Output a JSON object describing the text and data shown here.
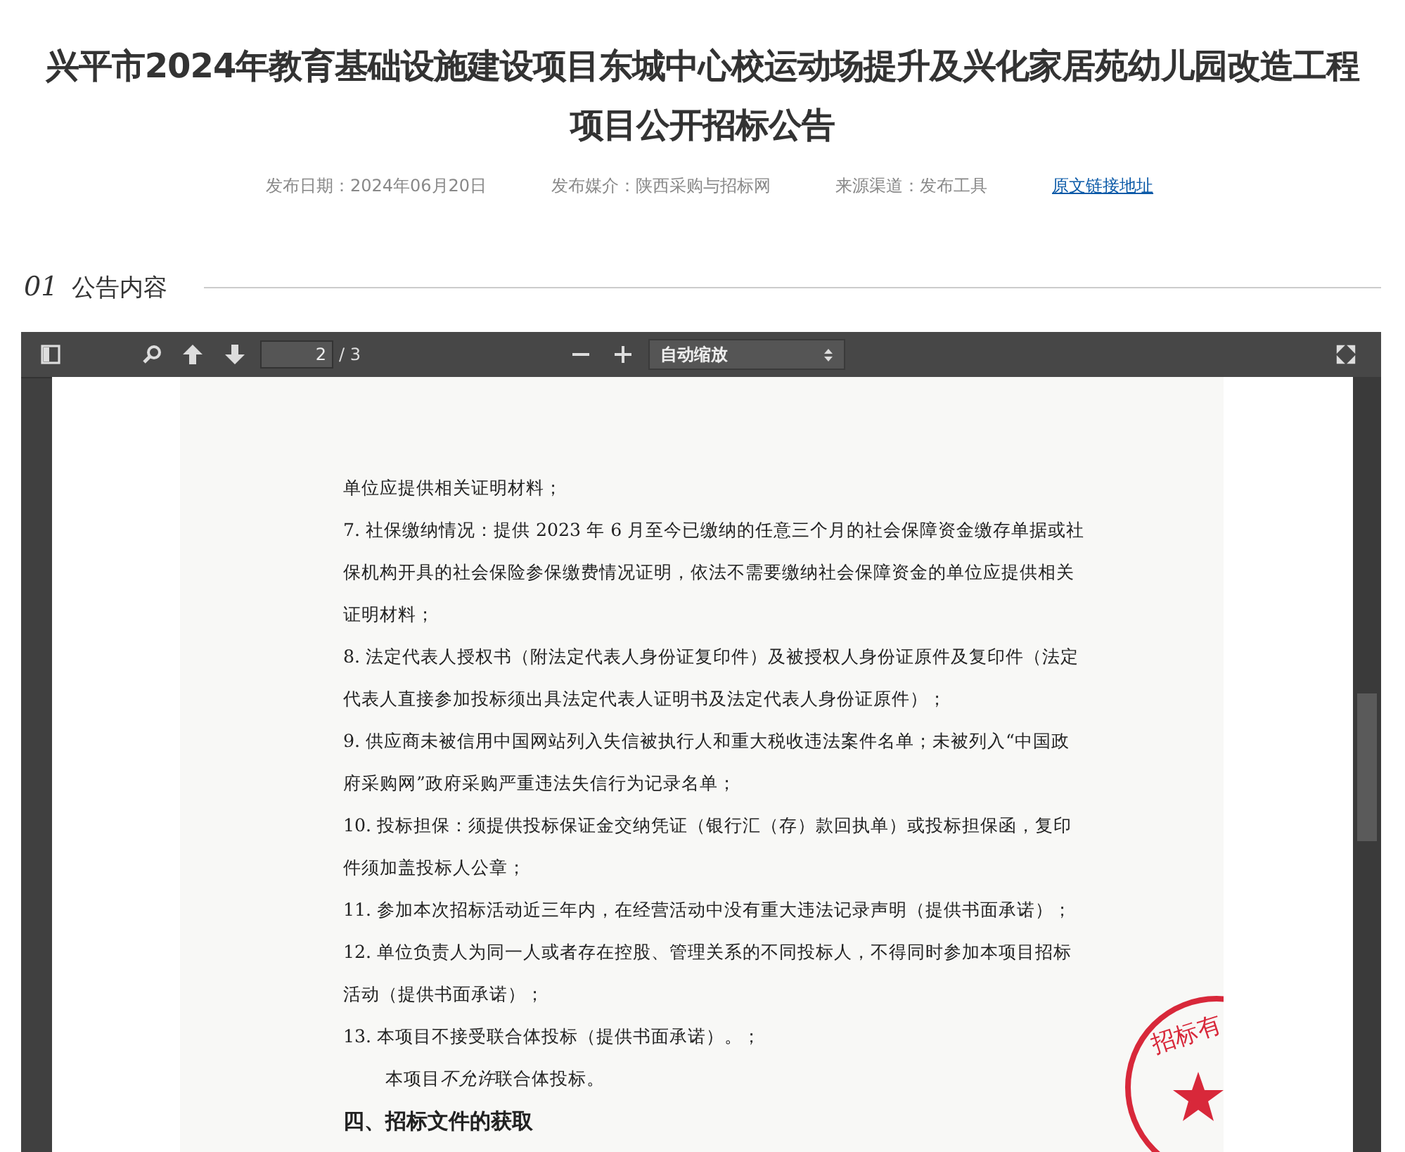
{
  "title": "兴平市2024年教育基础设施建设项目东城中心校运动场提升及兴化家居苑幼儿园改造工程项目公开招标公告",
  "meta": [
    {
      "kind": "text",
      "text": "发布日期：2024年06月20日"
    },
    {
      "kind": "text",
      "text": "发布媒介：陕西采购与招标网"
    },
    {
      "kind": "text",
      "text": "来源渠道：发布工具"
    },
    {
      "kind": "link",
      "text": "原文链接地址"
    }
  ],
  "section": {
    "number": "01",
    "title": "公告内容"
  },
  "viewer": {
    "page_value": "2",
    "page_total": "/ 3",
    "zoom": "自动缩放",
    "lines": [
      {
        "kind": "text",
        "text": "单位应提供相关证明材料；"
      },
      {
        "kind": "text",
        "text": "7. 社保缴纳情况：提供 2023 年 6 月至今已缴纳的任意三个月的社会保障资金缴存单据或社"
      },
      {
        "kind": "text",
        "text": "保机构开具的社会保险参保缴费情况证明，依法不需要缴纳社会保障资金的单位应提供相关"
      },
      {
        "kind": "text",
        "text": "证明材料；"
      },
      {
        "kind": "text",
        "text": "8. 法定代表人授权书（附法定代表人身份证复印件）及被授权人身份证原件及复印件（法定"
      },
      {
        "kind": "text",
        "text": "代表人直接参加投标须出具法定代表人证明书及法定代表人身份证原件）；"
      },
      {
        "kind": "text",
        "text": "9. 供应商未被信用中国网站列入失信被执行人和重大税收违法案件名单；未被列入“中国政"
      },
      {
        "kind": "text",
        "text": "府采购网”政府采购严重违法失信行为记录名单；"
      },
      {
        "kind": "text",
        "text": "10. 投标担保：须提供投标保证金交纳凭证（银行汇（存）款回执单）或投标担保函，复印"
      },
      {
        "kind": "text",
        "text": "件须加盖投标人公章；"
      },
      {
        "kind": "text",
        "text": "11. 参加本次招标活动近三年内，在经营活动中没有重大违法记录声明（提供书面承诺）；"
      },
      {
        "kind": "text",
        "text": "12. 单位负责人为同一人或者存在控股、管理关系的不同投标人，不得同时参加本项目招标"
      },
      {
        "kind": "text",
        "text": "活动（提供书面承诺）；"
      },
      {
        "kind": "text",
        "text": "13. 本项目不接受联合体投标（提供书面承诺）。；"
      },
      {
        "kind": "indent",
        "parts": [
          {
            "text": "本项目",
            "italic": false
          },
          {
            "text": "不允许",
            "italic": true
          },
          {
            "text": "联合体投标。",
            "italic": false
          }
        ]
      },
      {
        "kind": "heading",
        "text": "四、招标文件的获取"
      }
    ],
    "stamp_text": "招标有"
  }
}
